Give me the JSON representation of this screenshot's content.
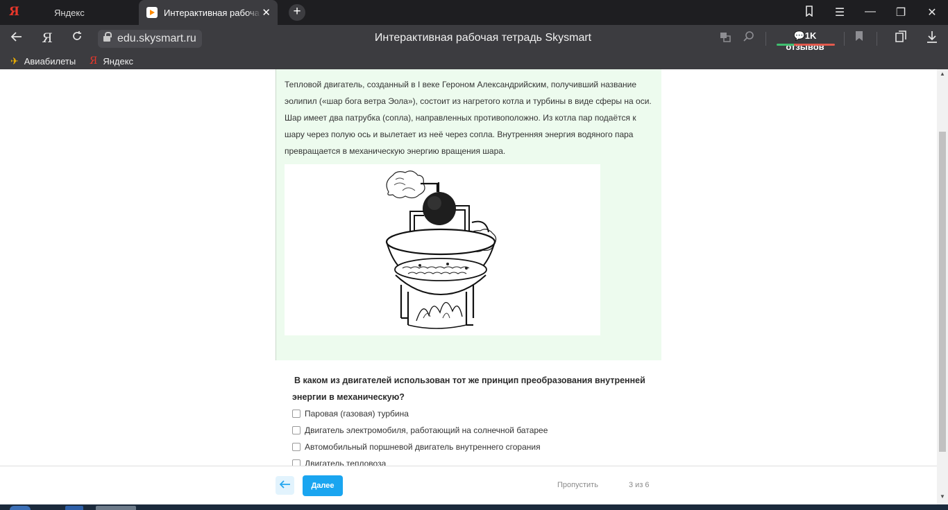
{
  "browser": {
    "tabs": [
      {
        "label": "Яндекс"
      },
      {
        "label": "Интерактивная рабоча"
      }
    ],
    "address": "edu.skysmart.ru",
    "page_title": "Интерактивная рабочая тетрадь Skysmart",
    "reviews_label": "1K отзывов",
    "bookmarks": [
      {
        "label": "Авиабилеты"
      },
      {
        "label": "Яндекс"
      }
    ]
  },
  "task": {
    "text": "Тепловой двигатель, созданный в I веке Героном Александрийским, получивший название эолипил («шар бога ветра Эола»), состоит из нагретого котла и турбины в виде сферы на оси. Шар имеет два патрубка (сопла), направленных противоположно. Из котла пар подаётся к шару через полую ось и вылетает из неё через сопла. Внутренняя энергия водяного пара превращается в механическую энергию вращения шара.",
    "question": "В каком из двигателей использован тот же принцип преобразования внутренней энергии в механическую?",
    "options": [
      {
        "label": "Паровая (газовая) турбина",
        "checked": false
      },
      {
        "label": "Двигатель электромобиля, работающий на солнечной батарее",
        "checked": false
      },
      {
        "label": "Автомобильный поршневой двигатель внутреннего сгорания",
        "checked": false
      },
      {
        "label": "Двигатель тепловоза",
        "checked": false
      }
    ]
  },
  "footer": {
    "next_label": "Далее",
    "skip_label": "Пропустить",
    "counter": "3 из 6"
  },
  "colors": {
    "accent": "#1aa5f0",
    "card_bg": "#edfbee",
    "chrome_dark": "#1e1e21",
    "chrome": "#3c3c40"
  },
  "icons": [
    "yandex-logo",
    "back-arrow-icon",
    "yandex-home-icon",
    "reload-icon",
    "lock-icon",
    "translate-icon",
    "search-icon",
    "comment-icon",
    "bookmark-icon",
    "collections-icon",
    "download-icon",
    "close-icon",
    "plus-icon",
    "minimize-icon",
    "maximize-icon",
    "menu-icon",
    "arrow-left-icon"
  ]
}
